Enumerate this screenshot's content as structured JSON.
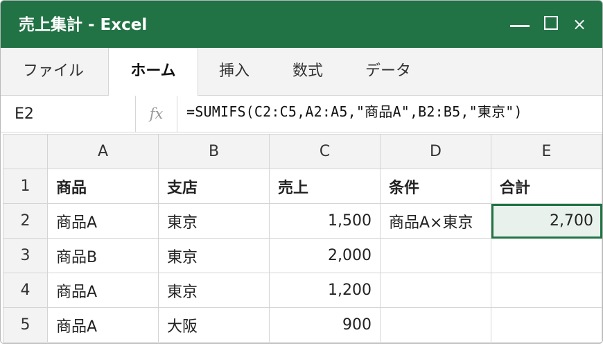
{
  "window": {
    "title": "売上集計 - Excel",
    "controls": {
      "minimize": "—",
      "maximize": "☐",
      "close": "×"
    }
  },
  "ribbon": {
    "tabs": [
      {
        "label": "ファイル",
        "active": false
      },
      {
        "label": "ホーム",
        "active": true
      },
      {
        "label": "挿入",
        "active": false
      },
      {
        "label": "数式",
        "active": false
      },
      {
        "label": "データ",
        "active": false
      }
    ]
  },
  "formula_bar": {
    "name_box": "E2",
    "fx_label": "fx",
    "formula": "=SUMIFS(C2:C5,A2:A5,\"商品A\",B2:B5,\"東京\")"
  },
  "sheet": {
    "columns": [
      "A",
      "B",
      "C",
      "D",
      "E"
    ],
    "rows": [
      {
        "num": "1",
        "cells": [
          "商品",
          "支店",
          "売上",
          "条件",
          "合計"
        ]
      },
      {
        "num": "2",
        "cells": [
          "商品A",
          "東京",
          "1,500",
          "商品A×東京",
          "2,700"
        ]
      },
      {
        "num": "3",
        "cells": [
          "商品B",
          "東京",
          "2,000",
          "",
          ""
        ]
      },
      {
        "num": "4",
        "cells": [
          "商品A",
          "東京",
          "1,200",
          "",
          ""
        ]
      },
      {
        "num": "5",
        "cells": [
          "商品A",
          "大阪",
          "900",
          "",
          ""
        ]
      }
    ],
    "selected_cell": "E2"
  },
  "colors": {
    "accent": "#217346",
    "selected_fill": "#e9f1ec"
  }
}
